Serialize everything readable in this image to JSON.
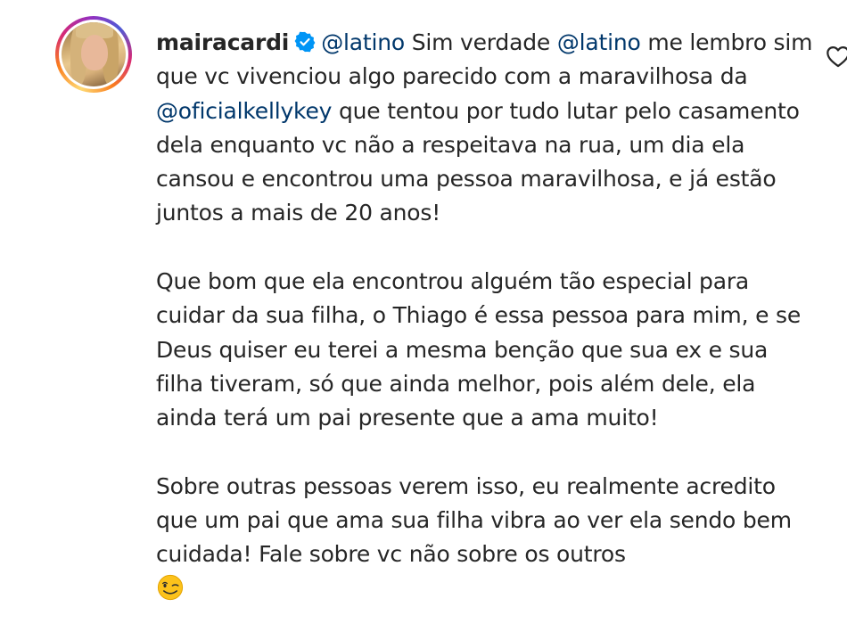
{
  "comment": {
    "username": "mairacardi",
    "verified_badge_icon": "verified-badge-icon",
    "avatar_icon": "profile-photo-avatar",
    "accent_mention_color": "#00376b",
    "text_color": "#262626",
    "mention_1": "@latino",
    "text_1": " Sim verdade ",
    "mention_2": "@latino",
    "text_2": " me lembro sim que vc vivenciou algo parecido com a maravilhosa da ",
    "mention_3": "@oficialkellykey",
    "text_3": " que tentou por tudo lutar pelo casamento dela enquanto vc não a respeitava na rua, um dia ela cansou e encontrou uma pessoa maravilhosa, e já estão juntos a mais de 20 anos!",
    "paragraph_2": "Que bom que ela encontrou alguém tão especial para cuidar da sua filha, o Thiago é essa pessoa para mim, e se Deus quiser eu terei a mesma benção que sua ex e sua filha tiveram, só que ainda melhor, pois além dele, ela ainda terá um pai presente que a ama muito!",
    "paragraph_3": "Sobre outras pessoas verem isso, eu realmente acredito que um pai que ama sua filha vibra ao ver ela sendo bem cuidada! Fale sobre vc não sobre os outros",
    "emoji_icon": "winking-face-emoji",
    "like_icon": "heart-outline-icon"
  }
}
